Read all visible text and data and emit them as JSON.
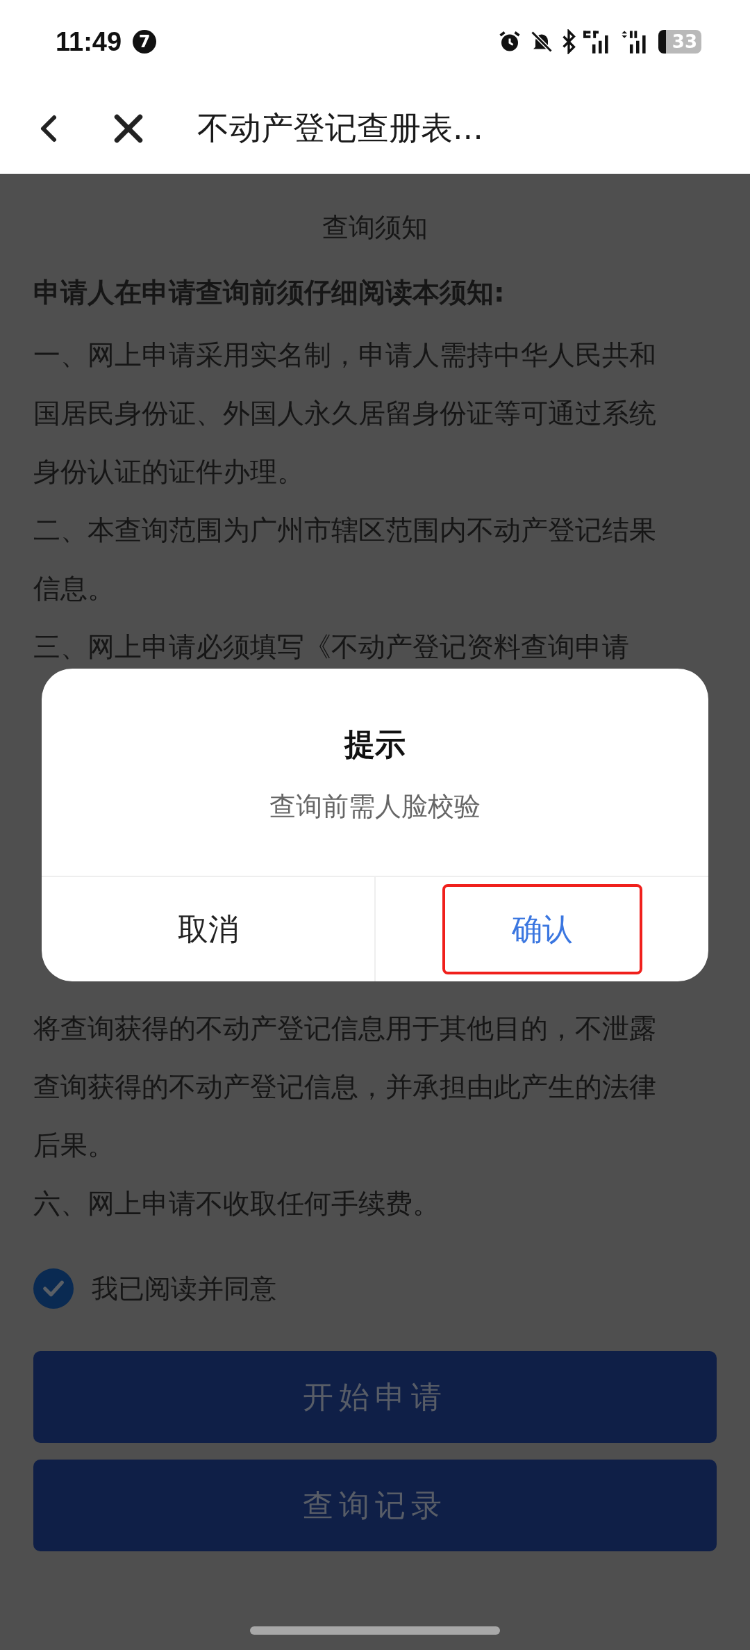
{
  "status_bar": {
    "time": "11:49",
    "notification_count": "7",
    "battery": "33"
  },
  "nav": {
    "title": "不动产登记查册表..."
  },
  "notice": {
    "title": "查询须知",
    "heading": "申请人在申请查询前须仔细阅读本须知:",
    "lines_before": [
      "一、网上申请采用实名制，申请人需持中华人民共和",
      "国居民身份证、外国人永久居留身份证等可通过系统",
      "身份认证的证件办理。",
      "二、本查询范围为广州市辖区范围内不动产登记结果",
      "信息。",
      "三、网上申请必须填写《不动产登记资料查询申请"
    ],
    "lines_after": [
      "将查询获得的不动产登记信息用于其他目的，不泄露",
      "查询获得的不动产登记信息，并承担由此产生的法律",
      "后果。",
      "六、网上申请不收取任何手续费。"
    ]
  },
  "agreement": {
    "label": "我已阅读并同意",
    "checked": true
  },
  "buttons": [
    {
      "label": "开始申请"
    },
    {
      "label": "查询记录"
    }
  ],
  "dialog": {
    "title": "提示",
    "message": "查询前需人脸校验",
    "actions": [
      {
        "label": "取消",
        "kind": "cancel",
        "highlighted": false
      },
      {
        "label": "确认",
        "kind": "confirm",
        "highlighted": true
      }
    ]
  }
}
